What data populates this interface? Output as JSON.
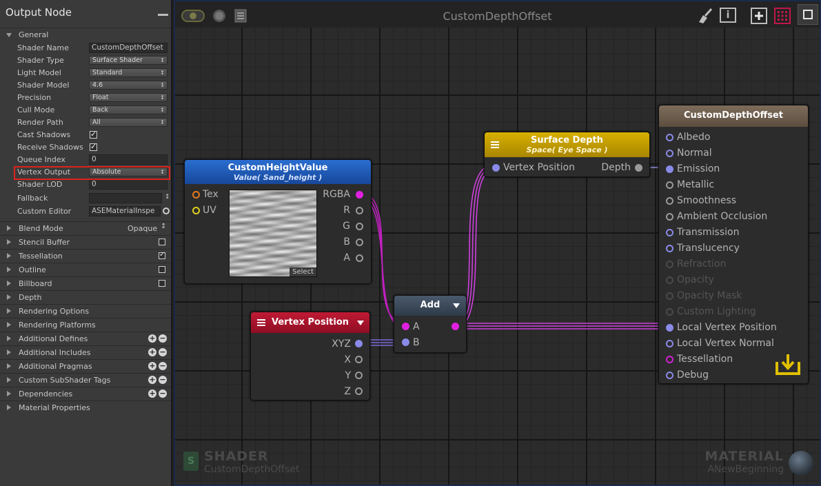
{
  "panel": {
    "title": "Output Node",
    "general_label": "General",
    "rows": [
      {
        "label": "Shader Name",
        "value": "CustomDepthOffset",
        "kind": "field"
      },
      {
        "label": "Shader Type",
        "value": "Surface Shader",
        "kind": "drop"
      },
      {
        "label": "Light Model",
        "value": "Standard",
        "kind": "drop"
      },
      {
        "label": "Shader Model",
        "value": "4.6",
        "kind": "drop"
      },
      {
        "label": "Precision",
        "value": "Float",
        "kind": "drop"
      },
      {
        "label": "Cull Mode",
        "value": "Back",
        "kind": "drop"
      },
      {
        "label": "Render Path",
        "value": "All",
        "kind": "drop"
      },
      {
        "label": "Cast Shadows",
        "checked": true,
        "kind": "check"
      },
      {
        "label": "Receive Shadows",
        "checked": true,
        "kind": "check"
      },
      {
        "label": "Queue Index",
        "value": "0",
        "kind": "field"
      },
      {
        "label": "Vertex Output",
        "value": "Absolute",
        "kind": "drop"
      },
      {
        "label": "Shader LOD",
        "value": "0",
        "kind": "field"
      },
      {
        "label": "Fallback",
        "value": "",
        "kind": "field"
      },
      {
        "label": "Custom Editor",
        "value": "ASEMaterialInspe",
        "kind": "field"
      }
    ],
    "sections": [
      {
        "label": "Blend Mode",
        "value": "Opaque"
      },
      {
        "label": "Stencil Buffer",
        "checked": false
      },
      {
        "label": "Tessellation",
        "checked": true
      },
      {
        "label": "Outline",
        "checked": false
      },
      {
        "label": "Billboard",
        "checked": false
      },
      {
        "label": "Depth"
      },
      {
        "label": "Rendering Options"
      },
      {
        "label": "Rendering Platforms"
      },
      {
        "label": "Additional Defines",
        "plusminus": true
      },
      {
        "label": "Additional Includes",
        "plusminus": true
      },
      {
        "label": "Additional Pragmas",
        "plusminus": true
      },
      {
        "label": "Custom SubShader Tags",
        "plusminus": true
      },
      {
        "label": "Dependencies",
        "plusminus": true
      },
      {
        "label": "Material Properties"
      }
    ]
  },
  "canvas": {
    "title": "CustomDepthOffset",
    "info_label": "i",
    "watermark_left_big": "SHADER",
    "watermark_left_small": "CustomDepthOffset",
    "watermark_right_big": "MATERIAL",
    "watermark_right_small": "ANewBeginning"
  },
  "nodes": {
    "height": {
      "title": "CustomHeightValue",
      "subtitle": "Value( Sand_height )",
      "inputs": [
        "Tex",
        "UV"
      ],
      "outputs": [
        "RGBA",
        "R",
        "G",
        "B",
        "A"
      ],
      "select_label": "Select",
      "color": "#1f5fb8"
    },
    "vertex": {
      "title": "Vertex Position",
      "outputs": [
        "XYZ",
        "X",
        "Y",
        "Z"
      ],
      "color": "#a8142c"
    },
    "add": {
      "title": "Add",
      "inputs": [
        "A",
        "B"
      ],
      "color": "#3c4a5a"
    },
    "depth": {
      "title": "Surface Depth",
      "subtitle": "Space( Eye Space )",
      "input": "Vertex Position",
      "output": "Depth",
      "color": "#c9a400"
    },
    "master": {
      "title": "CustomDepthOffset",
      "ports": [
        {
          "label": "Albedo",
          "enabled": true,
          "filled": false
        },
        {
          "label": "Normal",
          "enabled": true,
          "filled": false
        },
        {
          "label": "Emission",
          "enabled": true,
          "filled": true
        },
        {
          "label": "Metallic",
          "enabled": true,
          "filled": false
        },
        {
          "label": "Smoothness",
          "enabled": true,
          "filled": false
        },
        {
          "label": "Ambient Occlusion",
          "enabled": true,
          "filled": false
        },
        {
          "label": "Transmission",
          "enabled": true,
          "filled": false
        },
        {
          "label": "Translucency",
          "enabled": true,
          "filled": false
        },
        {
          "label": "Refraction",
          "enabled": false,
          "filled": false
        },
        {
          "label": "Opacity",
          "enabled": false,
          "filled": false
        },
        {
          "label": "Opacity Mask",
          "enabled": false,
          "filled": false
        },
        {
          "label": "Custom Lighting",
          "enabled": false,
          "filled": false
        },
        {
          "label": "Local Vertex Position",
          "enabled": true,
          "filled": true
        },
        {
          "label": "Local Vertex Normal",
          "enabled": true,
          "filled": false
        },
        {
          "label": "Tessellation",
          "enabled": true,
          "filled": false
        },
        {
          "label": "Debug",
          "enabled": true,
          "filled": false
        }
      ],
      "header_color": "#6e5e4e"
    }
  }
}
